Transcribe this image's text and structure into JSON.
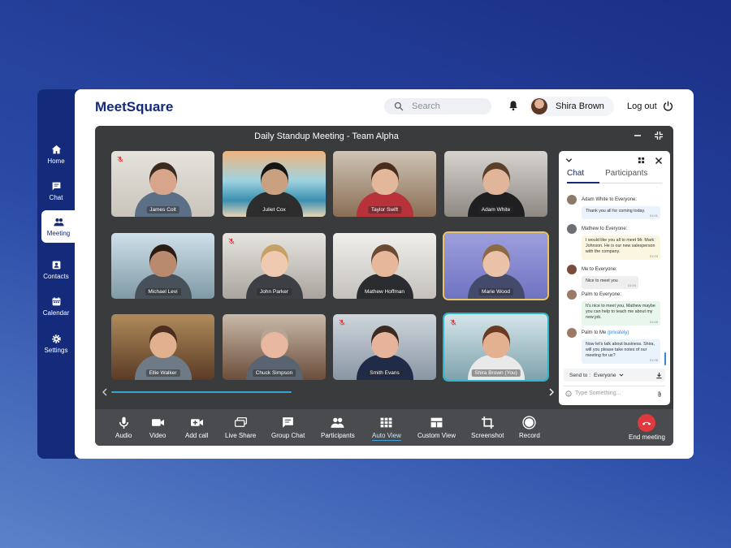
{
  "app": {
    "name": "MeetSquare"
  },
  "search": {
    "placeholder": "Search"
  },
  "user": {
    "name": "Shira Brown"
  },
  "logout_label": "Log out",
  "sidebar": {
    "items": [
      {
        "label": "Home",
        "icon": "home-icon"
      },
      {
        "label": "Chat",
        "icon": "chat-icon"
      },
      {
        "label": "Meeting",
        "icon": "people-icon",
        "active": true
      },
      {
        "label": "Contacts",
        "icon": "contacts-icon"
      },
      {
        "label": "Calendar",
        "icon": "calendar-icon"
      },
      {
        "label": "Settings",
        "icon": "gear-icon"
      }
    ]
  },
  "meeting": {
    "title": "Daily Standup Meeting - Team Alpha",
    "participants": [
      {
        "name": "James Colt",
        "muted": true
      },
      {
        "name": "Juliet Cox",
        "muted": false
      },
      {
        "name": "Taylor Swift",
        "muted": false
      },
      {
        "name": "Adam White",
        "muted": false
      },
      {
        "name": "Michael Levi",
        "muted": false
      },
      {
        "name": "John Parker",
        "muted": true
      },
      {
        "name": "Mathew Hoffman",
        "muted": false
      },
      {
        "name": "Marie Wood",
        "muted": false,
        "highlight": true
      },
      {
        "name": "Ellie Walker",
        "muted": false
      },
      {
        "name": "Chuck Simpson",
        "muted": false
      },
      {
        "name": "Smith Evans",
        "muted": true
      },
      {
        "name": "Shira Brown (You)",
        "muted": true,
        "speaking": true
      }
    ]
  },
  "chat": {
    "tabs": [
      "Chat",
      "Participants"
    ],
    "messages": [
      {
        "sender": "Adam White to Everyone:",
        "text": "Thank you all for coming today.",
        "time": "01:01"
      },
      {
        "sender": "Mathew to Everyone:",
        "text": "I would like you all to meet Mr. Mark Johnson. He is our new salesperson with the company.",
        "time": "01:03"
      },
      {
        "sender": "Me to Everyone:",
        "text": "Nice to meet you",
        "time": "01:04"
      },
      {
        "sender": "Palm to Everyone:",
        "text": "It's nice to meet you, Mathew maybe you can help to teach me about my new job.",
        "time": "01:05"
      },
      {
        "sender": "Palm to Me",
        "private_tag": "(privately)",
        "text": "Now let's talk about business. Shira, will you please take notes of our meeting for us?",
        "time": "01:05"
      }
    ],
    "send_to_label": "Send to :",
    "send_to_value": "Everyone",
    "input_placeholder": "Type Something..."
  },
  "toolbar": {
    "tools": [
      {
        "label": "Audio",
        "icon": "microphone-icon"
      },
      {
        "label": "Video",
        "icon": "video-camera-icon"
      },
      {
        "label": "Add call",
        "icon": "add-call-icon"
      },
      {
        "label": "Live Share",
        "icon": "screen-share-icon"
      },
      {
        "label": "Group Chat",
        "icon": "group-chat-icon"
      },
      {
        "label": "Participants",
        "icon": "participants-icon"
      },
      {
        "label": "Auto View",
        "icon": "grid-view-icon",
        "active": true
      },
      {
        "label": "Custom View",
        "icon": "custom-view-icon"
      },
      {
        "label": "Screenshot",
        "icon": "crop-icon"
      },
      {
        "label": "Record",
        "icon": "record-icon"
      }
    ],
    "end_label": "End meeting"
  },
  "colors": {
    "brand": "#142a7a",
    "accent": "#39a3d6",
    "end_call": "#e0393e",
    "speaking": "#2fb5c9",
    "highlight": "#e9c36a"
  }
}
